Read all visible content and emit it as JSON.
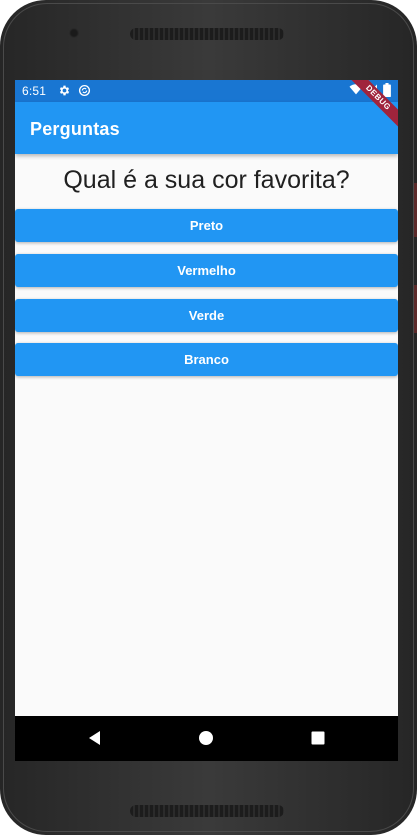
{
  "status_bar": {
    "time": "6:51",
    "color": "#1976d2"
  },
  "app_bar": {
    "title": "Perguntas",
    "color": "#2196f3"
  },
  "debug_banner": {
    "label": "DEBUG",
    "color": "#a0243c"
  },
  "question": {
    "text": "Qual é a sua cor favorita?"
  },
  "answers": [
    {
      "label": "Preto"
    },
    {
      "label": "Vermelho"
    },
    {
      "label": "Verde"
    },
    {
      "label": "Branco"
    }
  ],
  "icons": {
    "status_left": [
      "settings-icon",
      "sync-icon"
    ],
    "status_right": [
      "wifi-icon",
      "signal-icon",
      "battery-icon"
    ],
    "nav": [
      "back-icon",
      "home-icon",
      "recents-icon"
    ]
  }
}
